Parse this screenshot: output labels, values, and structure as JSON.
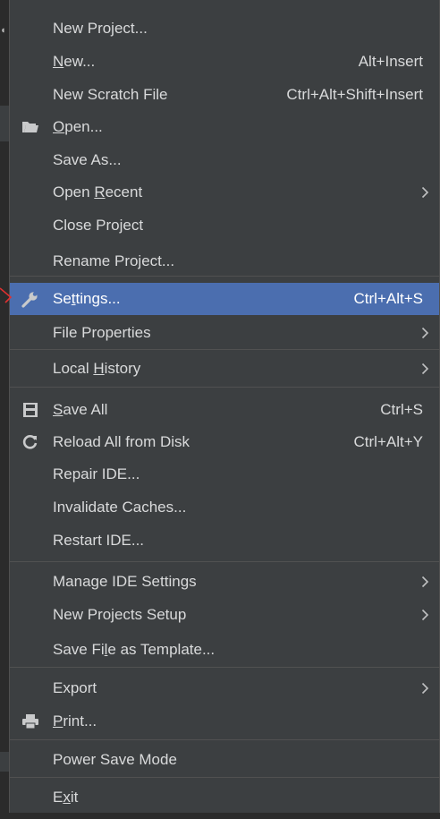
{
  "menu": {
    "items": [
      {
        "label": "New Project...",
        "mnemonic": "",
        "shortcut": "",
        "icon": "",
        "submenu": false
      },
      {
        "label": "New...",
        "mnemonic": "N",
        "shortcut": "Alt+Insert",
        "icon": "",
        "submenu": false
      },
      {
        "label": "New Scratch File",
        "mnemonic": "",
        "shortcut": "Ctrl+Alt+Shift+Insert",
        "icon": "",
        "submenu": false
      },
      {
        "label": "Open...",
        "mnemonic": "O",
        "shortcut": "",
        "icon": "folder-icon",
        "submenu": false
      },
      {
        "label": "Save As...",
        "mnemonic": "",
        "shortcut": "",
        "icon": "",
        "submenu": false
      },
      {
        "label": "Open Recent",
        "mnemonic": "R",
        "shortcut": "",
        "icon": "",
        "submenu": true
      },
      {
        "label": "Close Project",
        "mnemonic": "j",
        "shortcut": "",
        "icon": "",
        "submenu": false
      },
      {
        "label": "Rename Project...",
        "mnemonic": "",
        "shortcut": "",
        "icon": "",
        "submenu": false
      },
      {
        "label": "Settings...",
        "mnemonic": "t",
        "shortcut": "Ctrl+Alt+S",
        "icon": "wrench-icon",
        "submenu": false,
        "selected": true
      },
      {
        "label": "File Properties",
        "mnemonic": "",
        "shortcut": "",
        "icon": "",
        "submenu": true
      },
      {
        "label": "Local History",
        "mnemonic": "H",
        "shortcut": "",
        "icon": "",
        "submenu": true
      },
      {
        "label": "Save All",
        "mnemonic": "S",
        "shortcut": "Ctrl+S",
        "icon": "save-icon",
        "submenu": false
      },
      {
        "label": "Reload All from Disk",
        "mnemonic": "",
        "shortcut": "Ctrl+Alt+Y",
        "icon": "reload-icon",
        "submenu": false
      },
      {
        "label": "Repair IDE...",
        "mnemonic": "",
        "shortcut": "",
        "icon": "",
        "submenu": false
      },
      {
        "label": "Invalidate Caches...",
        "mnemonic": "",
        "shortcut": "",
        "icon": "",
        "submenu": false
      },
      {
        "label": "Restart IDE...",
        "mnemonic": "",
        "shortcut": "",
        "icon": "",
        "submenu": false
      },
      {
        "label": "Manage IDE Settings",
        "mnemonic": "",
        "shortcut": "",
        "icon": "",
        "submenu": true
      },
      {
        "label": "New Projects Setup",
        "mnemonic": "",
        "shortcut": "",
        "icon": "",
        "submenu": true
      },
      {
        "label": "Save File as Template...",
        "mnemonic": "l",
        "shortcut": "",
        "icon": "",
        "submenu": false
      },
      {
        "label": "Export",
        "mnemonic": "",
        "shortcut": "",
        "icon": "",
        "submenu": true
      },
      {
        "label": "Print...",
        "mnemonic": "P",
        "shortcut": "",
        "icon": "print-icon",
        "submenu": false
      },
      {
        "label": "Power Save Mode",
        "mnemonic": "",
        "shortcut": "",
        "icon": "",
        "submenu": false
      },
      {
        "label": "Exit",
        "mnemonic": "x",
        "shortcut": "",
        "icon": "",
        "submenu": false
      }
    ]
  },
  "colors": {
    "menu_background": "#3c3f41",
    "selection": "#4b6eaf",
    "text": "#d9dadb",
    "separator": "#515151",
    "annotation": "#e03030"
  }
}
